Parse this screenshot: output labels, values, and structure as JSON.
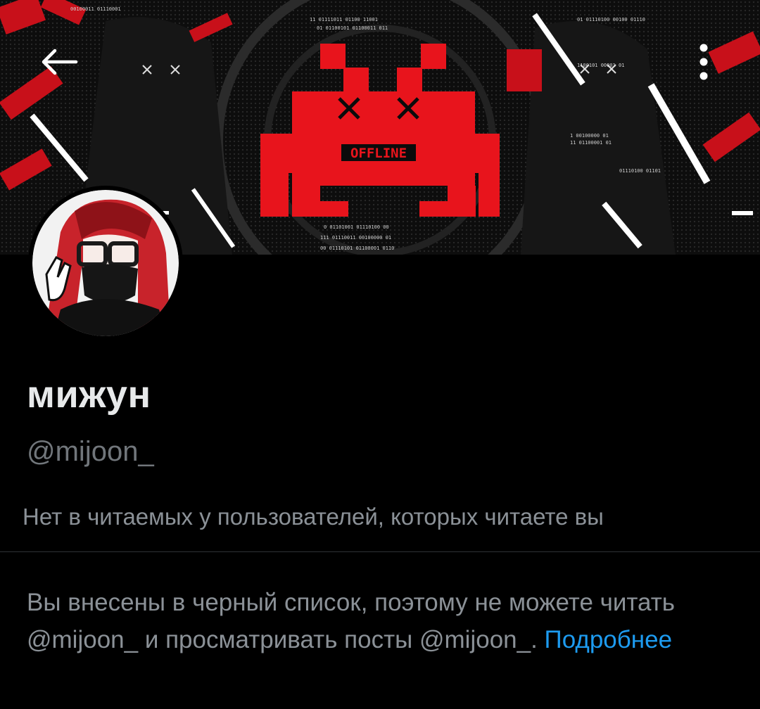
{
  "header": {
    "banner_text": "OFFLINE",
    "back_icon": "arrow-left-icon",
    "more_icon": "vertical-dots-icon"
  },
  "profile": {
    "display_name": "мижун",
    "handle": "@mijoon_",
    "followers_you_know": "Нет в читаемых у пользователей, которых читаете вы"
  },
  "blocked": {
    "message_part1": "Вы внесены в черный список, поэтому не можете читать @mijoon_ и просматривать посты @mijoon_. ",
    "learn_more": "Подробнее"
  },
  "colors": {
    "background": "#000000",
    "accent": "#1d9bf0",
    "banner_red": "#e8141c",
    "secondary_text": "#71767b"
  }
}
